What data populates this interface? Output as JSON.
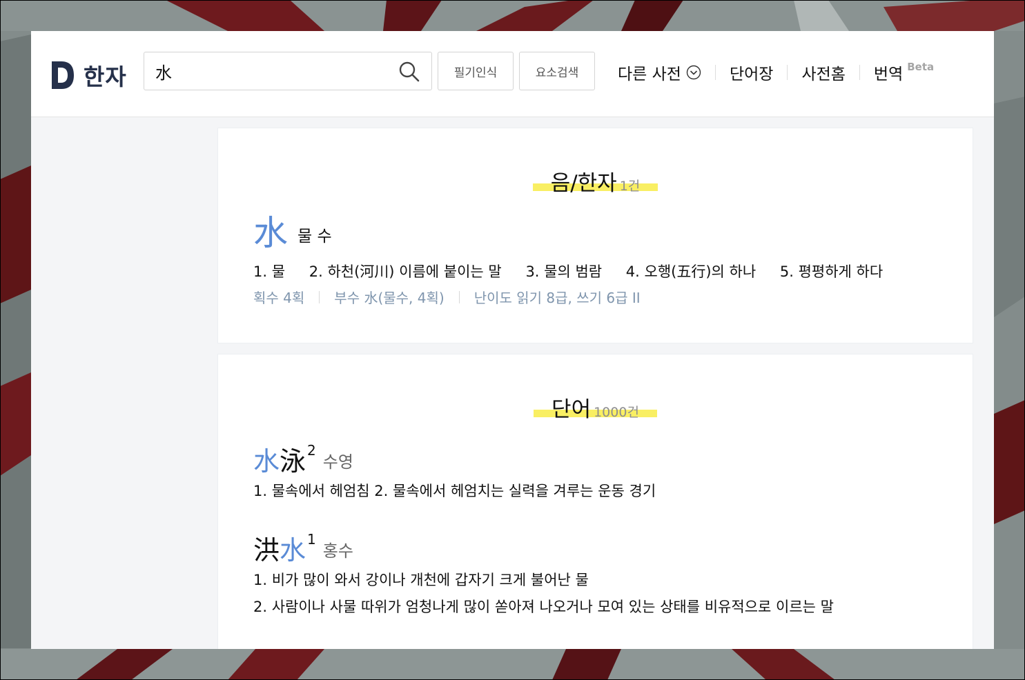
{
  "header": {
    "logo_text": "한자",
    "search_value": "水",
    "buttons": {
      "handwriting": "필기인식",
      "element_search": "요소검색"
    },
    "nav": [
      {
        "label": "다른 사전"
      },
      {
        "label": "단어장"
      },
      {
        "label": "사전홈"
      },
      {
        "label": "번역",
        "badge": "Beta"
      }
    ]
  },
  "hanja_section": {
    "title": "음/한자",
    "count": "1건",
    "entry": {
      "char": "水",
      "reading": "물 수",
      "meanings": [
        "1. 물",
        "2. 하천(河川) 이름에 붙이는 말",
        "3. 물의 범람",
        "4. 오행(五行)의 하나",
        "5. 평평하게 하다"
      ],
      "strokes": "획수 4획",
      "radical": "부수 水(물수, 4획)",
      "difficulty": "난이도 읽기 8급, 쓰기 6급 II"
    }
  },
  "word_section": {
    "title": "단어",
    "count": "1000건",
    "words": [
      {
        "chars": [
          "水",
          "泳"
        ],
        "highlight_index": 0,
        "sup": "2",
        "reading": "수영",
        "definitions": [
          "1. 물속에서 헤엄침   2. 물속에서 헤엄치는 실력을 겨루는 운동 경기"
        ]
      },
      {
        "chars": [
          "洪",
          "水"
        ],
        "highlight_index": 1,
        "sup": "1",
        "reading": "홍수",
        "definitions": [
          "1. 비가 많이 와서 강이나 개천에 갑자기 크게 불어난 물",
          "2. 사람이나 사물 따위가 엄청나게 많이 쏟아져 나오거나 모여 있는 상태를 비유적으로 이르는 말"
        ]
      }
    ]
  },
  "colors": {
    "accent_blue": "#5a8bd6",
    "highlight_yellow": "#f9ef63",
    "logo_navy": "#25304a",
    "meta_gray_blue": "#7f95ad"
  }
}
